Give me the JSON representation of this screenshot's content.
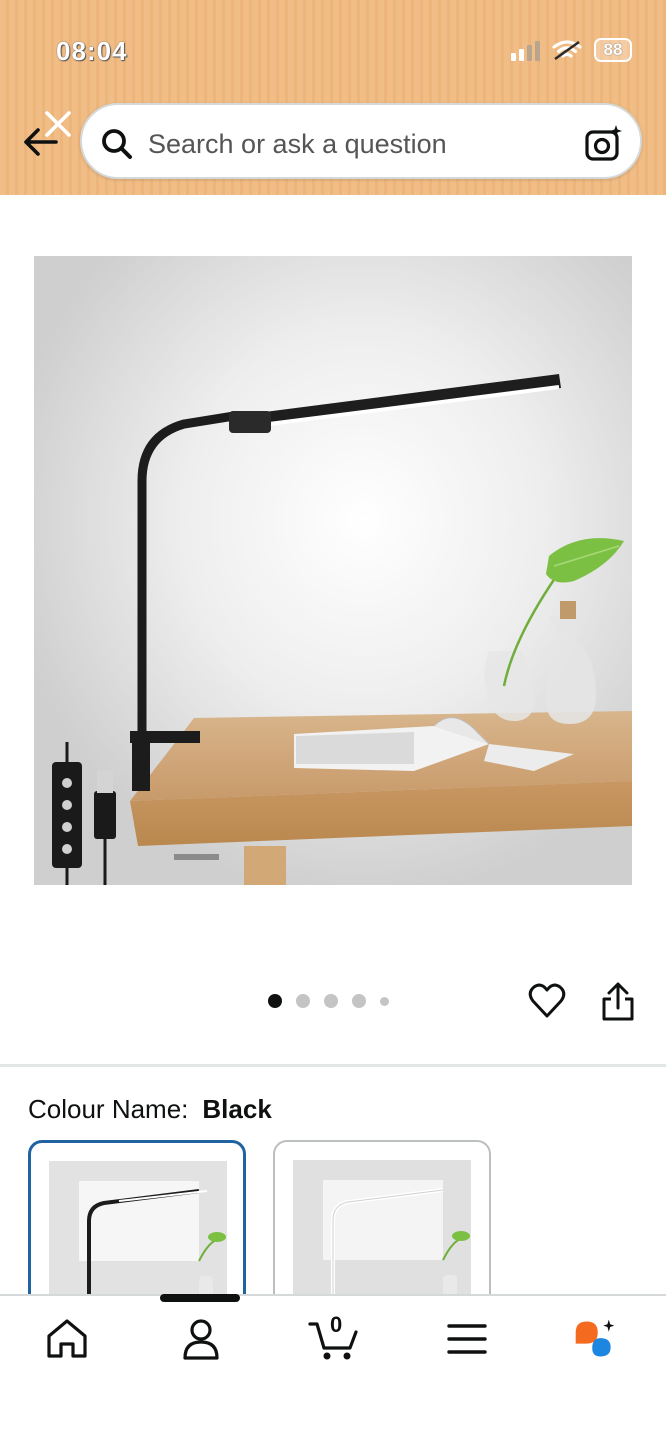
{
  "status_bar": {
    "time": "08:04",
    "battery": "88"
  },
  "search": {
    "placeholder": "Search or ask a question"
  },
  "carousel": {
    "total": 5,
    "active": 1
  },
  "colour": {
    "label": "Colour Name:",
    "value": "Black"
  },
  "cart": {
    "count": "0"
  },
  "icons": [
    "back-arrow-icon",
    "close-icon",
    "search-icon",
    "camera-icon",
    "heart-icon",
    "share-icon",
    "home-icon",
    "account-icon",
    "cart-icon",
    "menu-icon",
    "rufus-icon"
  ],
  "colors": {
    "header": "#f0bd86",
    "swatch_selected": "#2162a1",
    "rufus_orange": "#f46b20",
    "rufus_blue": "#1d86e0"
  }
}
